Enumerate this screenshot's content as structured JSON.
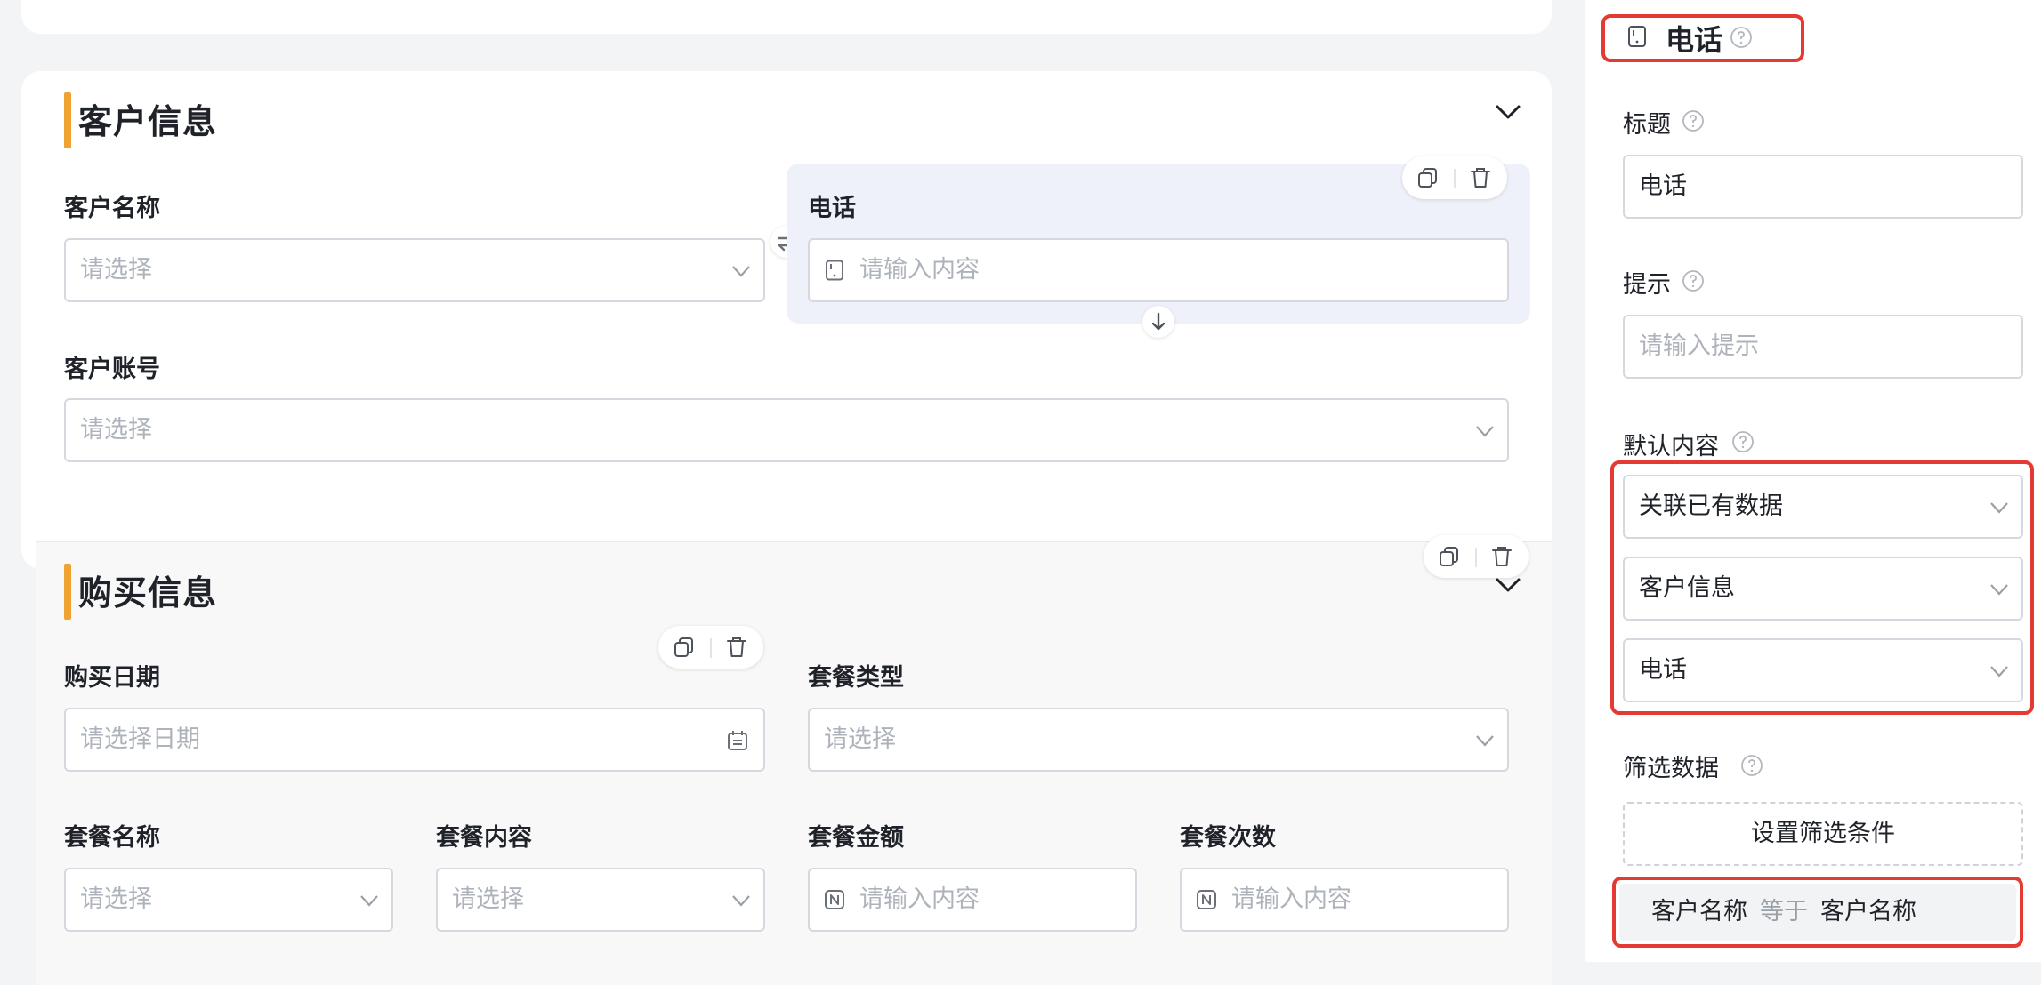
{
  "customer_section": {
    "title": "客户信息",
    "customer_name": {
      "label": "客户名称",
      "placeholder": "请选择"
    },
    "phone": {
      "label": "电话",
      "placeholder": "请输入内容"
    },
    "customer_account": {
      "label": "客户账号",
      "placeholder": "请选择"
    }
  },
  "purchase_section": {
    "title": "购买信息",
    "purchase_date": {
      "label": "购买日期",
      "placeholder": "请选择日期"
    },
    "package_type": {
      "label": "套餐类型",
      "placeholder": "请选择"
    },
    "package_name": {
      "label": "套餐名称",
      "placeholder": "请选择"
    },
    "package_content": {
      "label": "套餐内容",
      "placeholder": "请选择"
    },
    "package_amount": {
      "label": "套餐金额",
      "placeholder": "请输入内容"
    },
    "package_count": {
      "label": "套餐次数",
      "placeholder": "请输入内容"
    }
  },
  "properties": {
    "field_type": "电话",
    "title_label": "标题",
    "title_value": "电话",
    "hint_label": "提示",
    "hint_placeholder": "请输入提示",
    "default_label": "默认内容",
    "default_mode": "关联已有数据",
    "default_form": "客户信息",
    "default_field": "电话",
    "filter_label": "筛选数据",
    "filter_button": "设置筛选条件",
    "condition": {
      "left": "客户名称",
      "op": "等于",
      "right": "客户名称"
    }
  },
  "icons": [
    "phone-icon",
    "help-icon",
    "chevron-down-icon",
    "copy-icon",
    "delete-icon",
    "swap-icon",
    "arrow-down-icon",
    "calendar-icon",
    "number-icon",
    "collapse-icon"
  ],
  "colors": {
    "accent": "#f0a232",
    "highlight": "#e53a33",
    "selected_bg": "#eef1fa"
  }
}
